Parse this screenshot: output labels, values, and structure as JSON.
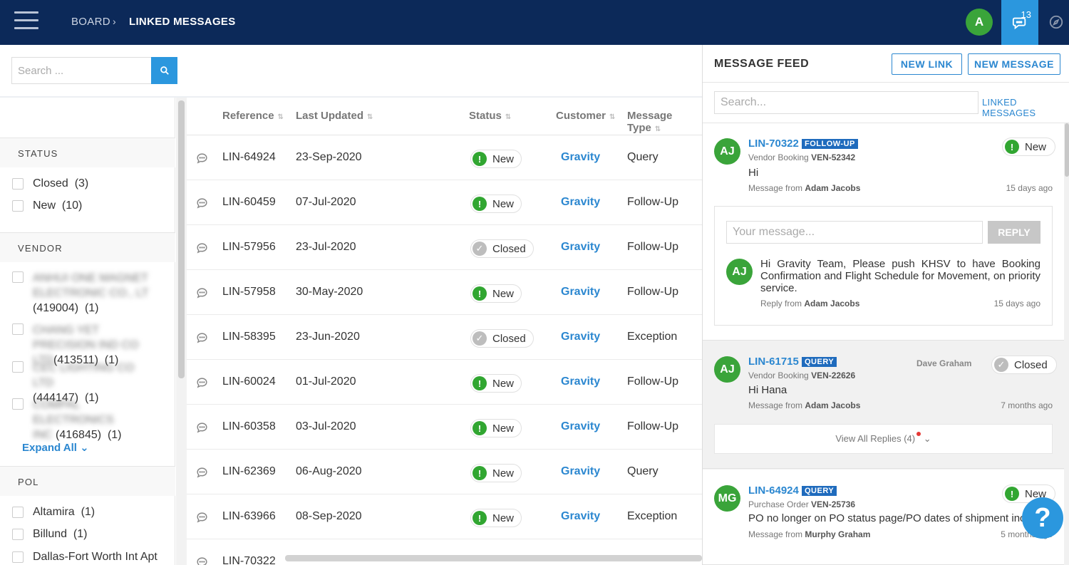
{
  "header": {
    "breadcrumb": [
      "BOARD",
      "LINKED MESSAGES"
    ],
    "avatar_initial": "A",
    "notification_count": "13",
    "colors": {
      "topbar": "#0c2959",
      "accent": "#2b97de"
    }
  },
  "search": {
    "placeholder": "Search ..."
  },
  "filters": {
    "status": {
      "title": "STATUS",
      "items": [
        {
          "label": "Closed",
          "count": "(3)"
        },
        {
          "label": "New",
          "count": "(10)"
        }
      ]
    },
    "vendor": {
      "title": "VENDOR",
      "items": [
        {
          "name": "ANHUI ONE MAGNET ELECTRONIC CO., LT",
          "code": "(419004)",
          "count": "(1)"
        },
        {
          "name": "CHANG YET PRECISION IND CO LTD",
          "code": "(413511)",
          "count": "(1)"
        },
        {
          "name": "CEC LIGHTING CO LTD",
          "code": "(444147)",
          "count": "(1)"
        },
        {
          "name": "COMPAL ELECTRONICS INC",
          "code": "(416845)",
          "count": "(1)"
        }
      ],
      "expand_label": "Expand All"
    },
    "pol": {
      "title": "POL",
      "items": [
        {
          "label": "Altamira",
          "count": "(1)"
        },
        {
          "label": "Billund",
          "count": "(1)"
        },
        {
          "label": "Dallas-Fort Worth Int Apt",
          "count": ""
        }
      ]
    }
  },
  "table": {
    "columns": [
      "Reference",
      "Last Updated",
      "Status",
      "Customer",
      "Message Type"
    ],
    "rows": [
      {
        "ref": "LIN-64924",
        "date": "23-Sep-2020",
        "status": "New",
        "customer": "Gravity",
        "type": "Query"
      },
      {
        "ref": "LIN-60459",
        "date": "07-Jul-2020",
        "status": "New",
        "customer": "Gravity",
        "type": "Follow-Up"
      },
      {
        "ref": "LIN-57956",
        "date": "23-Jul-2020",
        "status": "Closed",
        "customer": "Gravity",
        "type": "Follow-Up"
      },
      {
        "ref": "LIN-57958",
        "date": "30-May-2020",
        "status": "New",
        "customer": "Gravity",
        "type": "Follow-Up"
      },
      {
        "ref": "LIN-58395",
        "date": "23-Jun-2020",
        "status": "Closed",
        "customer": "Gravity",
        "type": "Exception"
      },
      {
        "ref": "LIN-60024",
        "date": "01-Jul-2020",
        "status": "New",
        "customer": "Gravity",
        "type": "Follow-Up"
      },
      {
        "ref": "LIN-60358",
        "date": "03-Jul-2020",
        "status": "New",
        "customer": "Gravity",
        "type": "Follow-Up"
      },
      {
        "ref": "LIN-62369",
        "date": "06-Aug-2020",
        "status": "New",
        "customer": "Gravity",
        "type": "Query"
      },
      {
        "ref": "LIN-63966",
        "date": "08-Sep-2020",
        "status": "New",
        "customer": "Gravity",
        "type": "Exception"
      },
      {
        "ref": "LIN-70322",
        "date": "",
        "status": "",
        "customer": "",
        "type": ""
      }
    ]
  },
  "feed": {
    "title": "MESSAGE FEED",
    "new_link_label": "NEW LINK",
    "new_message_label": "NEW MESSAGE",
    "search_placeholder": "Search...",
    "linked_messages_label": "LINKED MESSAGES",
    "cards": [
      {
        "initials": "AJ",
        "ref": "LIN-70322",
        "tag": "FOLLOW-UP",
        "sub_label": "Vendor Booking",
        "sub_ref": "VEN-52342",
        "body": "Hi",
        "from_label": "Message from",
        "from": "Adam Jacobs",
        "ago": "15 days ago",
        "status": "New",
        "reply_placeholder": "Your message...",
        "reply_button": "REPLY",
        "reply": {
          "initials": "AJ",
          "body": "Hi Gravity Team, Please push KHSV to have Booking Confirmation and Flight Schedule for Movement, on priority service.",
          "from_label": "Reply from",
          "from": "Adam Jacobs",
          "ago": "15 days ago"
        }
      },
      {
        "initials": "AJ",
        "ref": "LIN-61715",
        "tag": "QUERY",
        "sub_label": "Vendor Booking",
        "sub_ref": "VEN-22626",
        "assignee": "Dave Graham",
        "body": "Hi Hana",
        "from_label": "Message from",
        "from": "Adam Jacobs",
        "ago": "7 months ago",
        "status": "Closed",
        "view_replies": "View All Replies (4)"
      },
      {
        "initials": "MG",
        "ref": "LIN-64924",
        "tag": "QUERY",
        "sub_label": "Purchase Order",
        "sub_ref": "VEN-25736",
        "body": "PO no longer on PO status page/PO dates of shipment incorrect",
        "from_label": "Message from",
        "from": "Murphy Graham",
        "ago": "5 months ago",
        "status": "New"
      }
    ]
  },
  "help_icon": "?"
}
